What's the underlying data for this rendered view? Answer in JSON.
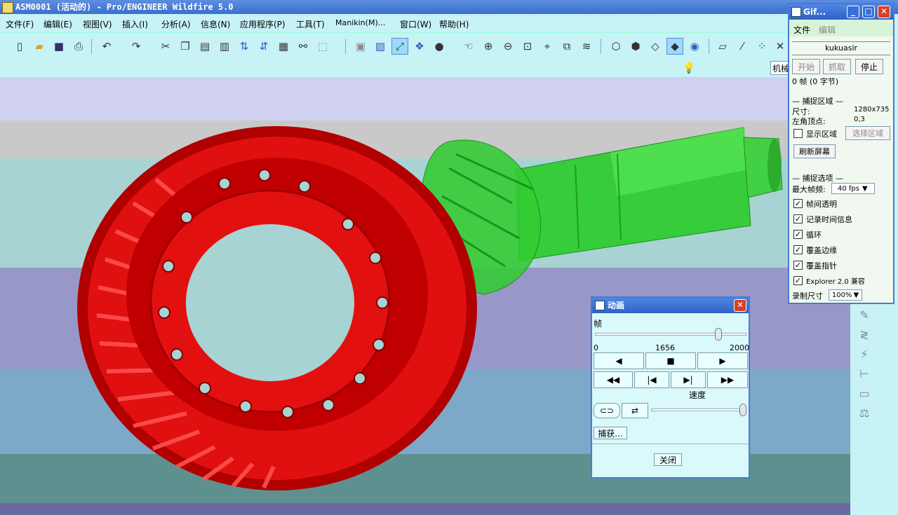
{
  "window": {
    "title": "ASM0001 (活动的) - Pro/ENGINEER Wildfire 5.0"
  },
  "menu": [
    "文件(F)",
    "编辑(E)",
    "视图(V)",
    "插入(I)",
    "分析(A)",
    "信息(N)",
    "应用程序(P)",
    "工具(T)",
    "Manikin(M)...",
    "窗口(W)",
    "帮助(H)"
  ],
  "toolbar2": {
    "mechanism_label": "机械"
  },
  "animation_dialog": {
    "title": "动画",
    "frame_label": "帧",
    "slider_min": "0",
    "slider_current": "1656",
    "slider_max": "2000",
    "frame_position": 0.83,
    "speed_label": "速度",
    "speed_position": 1.0,
    "capture_label": "捕获...",
    "close_label": "关闭"
  },
  "gif_dialog": {
    "title": "Gif...",
    "menu_file": "文件",
    "menu_edit": "编辑",
    "user": "kukuasir",
    "start_label": "开始",
    "grab_label": "抓取",
    "stop_label": "停止",
    "frames_info": "0 帧 (0 字节)",
    "capture_area_title": "捕捉区域",
    "size_label": "尺寸:",
    "size_value": "1280x735",
    "origin_label": "左角顶点:",
    "origin_value": "0,3",
    "show_area_label": "显示区域",
    "select_area_label": "选择区域",
    "refresh_label": "刷新屏幕",
    "capture_options_title": "捕捉选项",
    "max_fps_label": "最大帧频:",
    "max_fps_value": "40 fps",
    "options": [
      {
        "label": "帧间透明",
        "checked": true
      },
      {
        "label": "记录时间信息",
        "checked": true
      },
      {
        "label": "循环",
        "checked": true
      },
      {
        "label": "覆盖边缘",
        "checked": true
      },
      {
        "label": "覆盖指针",
        "checked": true
      },
      {
        "label": "Explorer 2.0 兼容",
        "checked": true
      }
    ],
    "record_size_label": "录制尺寸",
    "record_size_value": "100%"
  },
  "colors": {
    "ring_gear": "#d40000",
    "pinion": "#22cc22",
    "bg_accent": "#c7f2f6"
  }
}
